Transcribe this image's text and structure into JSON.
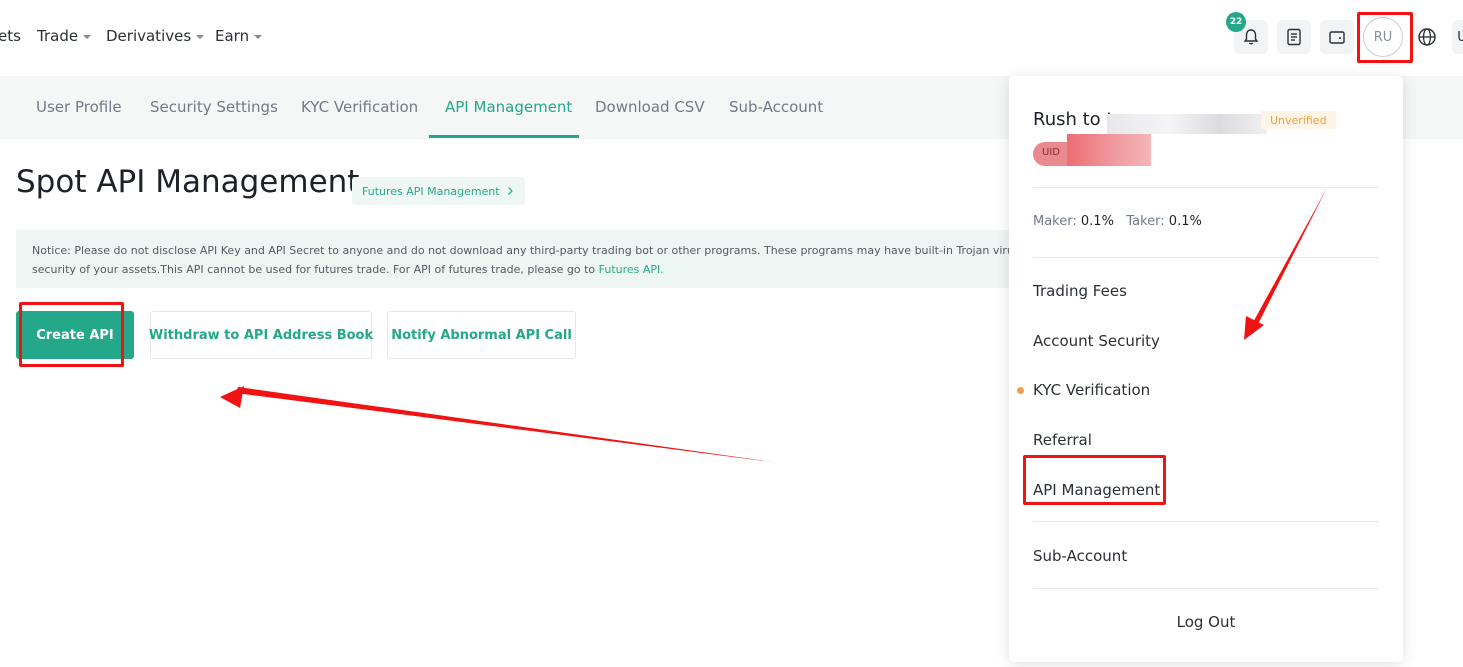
{
  "topnav": {
    "items": [
      {
        "label": "ets",
        "caret": false
      },
      {
        "label": "Trade",
        "caret": true
      },
      {
        "label": "Derivatives",
        "caret": true
      },
      {
        "label": "Earn",
        "caret": true
      }
    ],
    "notification_count": "22",
    "avatar_initials": "RU",
    "right_edge_text": "U"
  },
  "subnav": {
    "tabs": [
      "User Profile",
      "Security Settings",
      "KYC Verification",
      "API Management",
      "Download CSV",
      "Sub-Account"
    ],
    "active": "API Management"
  },
  "main": {
    "title": "Spot API Management",
    "futures_link": "Futures API Management",
    "notice_line1": "Notice: Please do not disclose API Key and API Secret to anyone and do not download any third-party trading bot or other programs. These programs may have built-in Trojan viruses and wil",
    "notice_line2_prefix": "security of your assets.This API cannot be used for futures trade. For API of futures trade, please go to ",
    "notice_line2_link": "Futures API.",
    "buttons": {
      "create": "Create API",
      "withdraw": "Withdraw to API Address Book",
      "notify": "Notify Abnormal API Call"
    }
  },
  "dropdown": {
    "name_visible": "Rush to t",
    "status_badge": "Unverified",
    "uid_label": "UID",
    "maker_label": "Maker:",
    "maker_value": "0.1%",
    "taker_label": "Taker:",
    "taker_value": "0.1%",
    "menu": [
      "Trading Fees",
      "Account Security",
      "KYC Verification",
      "Referral",
      "API Management",
      "Sub-Account"
    ],
    "logout": "Log Out"
  },
  "colors": {
    "accent": "#25a889",
    "annotation": "#f31212",
    "warning": "#f0a04b"
  }
}
